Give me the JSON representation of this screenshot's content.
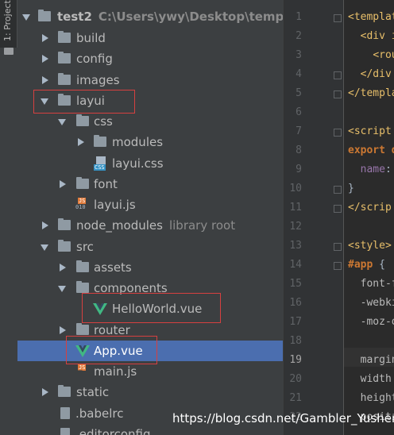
{
  "toolstrip": {
    "project_tab_label": "1: Project"
  },
  "tree": {
    "rows": [
      {
        "label": "test2",
        "hint": "C:\\Users\\ywy\\Desktop\\temp\\前后"
      },
      {
        "label": "build"
      },
      {
        "label": "config"
      },
      {
        "label": "images"
      },
      {
        "label": "layui"
      },
      {
        "label": "css"
      },
      {
        "label": "modules"
      },
      {
        "label": "layui.css"
      },
      {
        "label": "font"
      },
      {
        "label": "layui.js"
      },
      {
        "label": "node_modules",
        "hint": "library root"
      },
      {
        "label": "src"
      },
      {
        "label": "assets"
      },
      {
        "label": "components"
      },
      {
        "label": "HelloWorld.vue"
      },
      {
        "label": "router"
      },
      {
        "label": "App.vue"
      },
      {
        "label": "main.js"
      },
      {
        "label": "static"
      },
      {
        "label": ".babelrc"
      },
      {
        "label": ".editorconfig"
      }
    ],
    "selected": "App.vue"
  },
  "editor": {
    "line_numbers": [
      "1",
      "2",
      "3",
      "4",
      "5",
      "6",
      "7",
      "8",
      "9",
      "10",
      "11",
      "12",
      "13",
      "14",
      "15",
      "16",
      "17",
      "18",
      "19",
      "20",
      "21",
      "22"
    ],
    "current_line": "19",
    "lines": [
      {
        "parts": [
          [
            "tag",
            "<templat"
          ]
        ]
      },
      {
        "parts": [
          [
            "plain",
            "  "
          ],
          [
            "tag",
            "<div i"
          ]
        ]
      },
      {
        "parts": [
          [
            "plain",
            "    "
          ],
          [
            "tag",
            "<rou"
          ]
        ]
      },
      {
        "parts": [
          [
            "plain",
            "  "
          ],
          [
            "tag",
            "</div"
          ]
        ]
      },
      {
        "parts": [
          [
            "tag",
            "</templa"
          ]
        ]
      },
      {
        "parts": []
      },
      {
        "parts": [
          [
            "tag",
            "<script"
          ]
        ]
      },
      {
        "parts": [
          [
            "kw",
            "export d"
          ]
        ]
      },
      {
        "parts": [
          [
            "plain",
            "  "
          ],
          [
            "prop",
            "name"
          ],
          [
            "plain",
            ":"
          ]
        ]
      },
      {
        "parts": [
          [
            "plain",
            "}"
          ]
        ]
      },
      {
        "parts": [
          [
            "tag",
            "</scrip"
          ]
        ]
      },
      {
        "parts": []
      },
      {
        "parts": [
          [
            "tag",
            "<style>"
          ]
        ]
      },
      {
        "parts": [
          [
            "kw",
            "#app"
          ],
          [
            "plain",
            " {"
          ]
        ]
      },
      {
        "parts": [
          [
            "plain",
            "  "
          ],
          [
            "css",
            "font-f"
          ]
        ]
      },
      {
        "parts": [
          [
            "plain",
            "  "
          ],
          [
            "css",
            "-webki"
          ]
        ]
      },
      {
        "parts": [
          [
            "plain",
            "  "
          ],
          [
            "css",
            "-moz-o"
          ]
        ]
      },
      {
        "parts": []
      },
      {
        "parts": [
          [
            "plain",
            "  "
          ],
          [
            "css",
            "margin"
          ]
        ]
      },
      {
        "parts": [
          [
            "plain",
            "  "
          ],
          [
            "css",
            "width"
          ]
        ]
      },
      {
        "parts": [
          [
            "plain",
            "  "
          ],
          [
            "css",
            "height"
          ]
        ]
      },
      {
        "parts": [
          [
            "plain",
            "  "
          ],
          [
            "css",
            "positi"
          ]
        ]
      }
    ]
  },
  "watermark": "https://blog.csdn.net/Gambler_Yushen"
}
